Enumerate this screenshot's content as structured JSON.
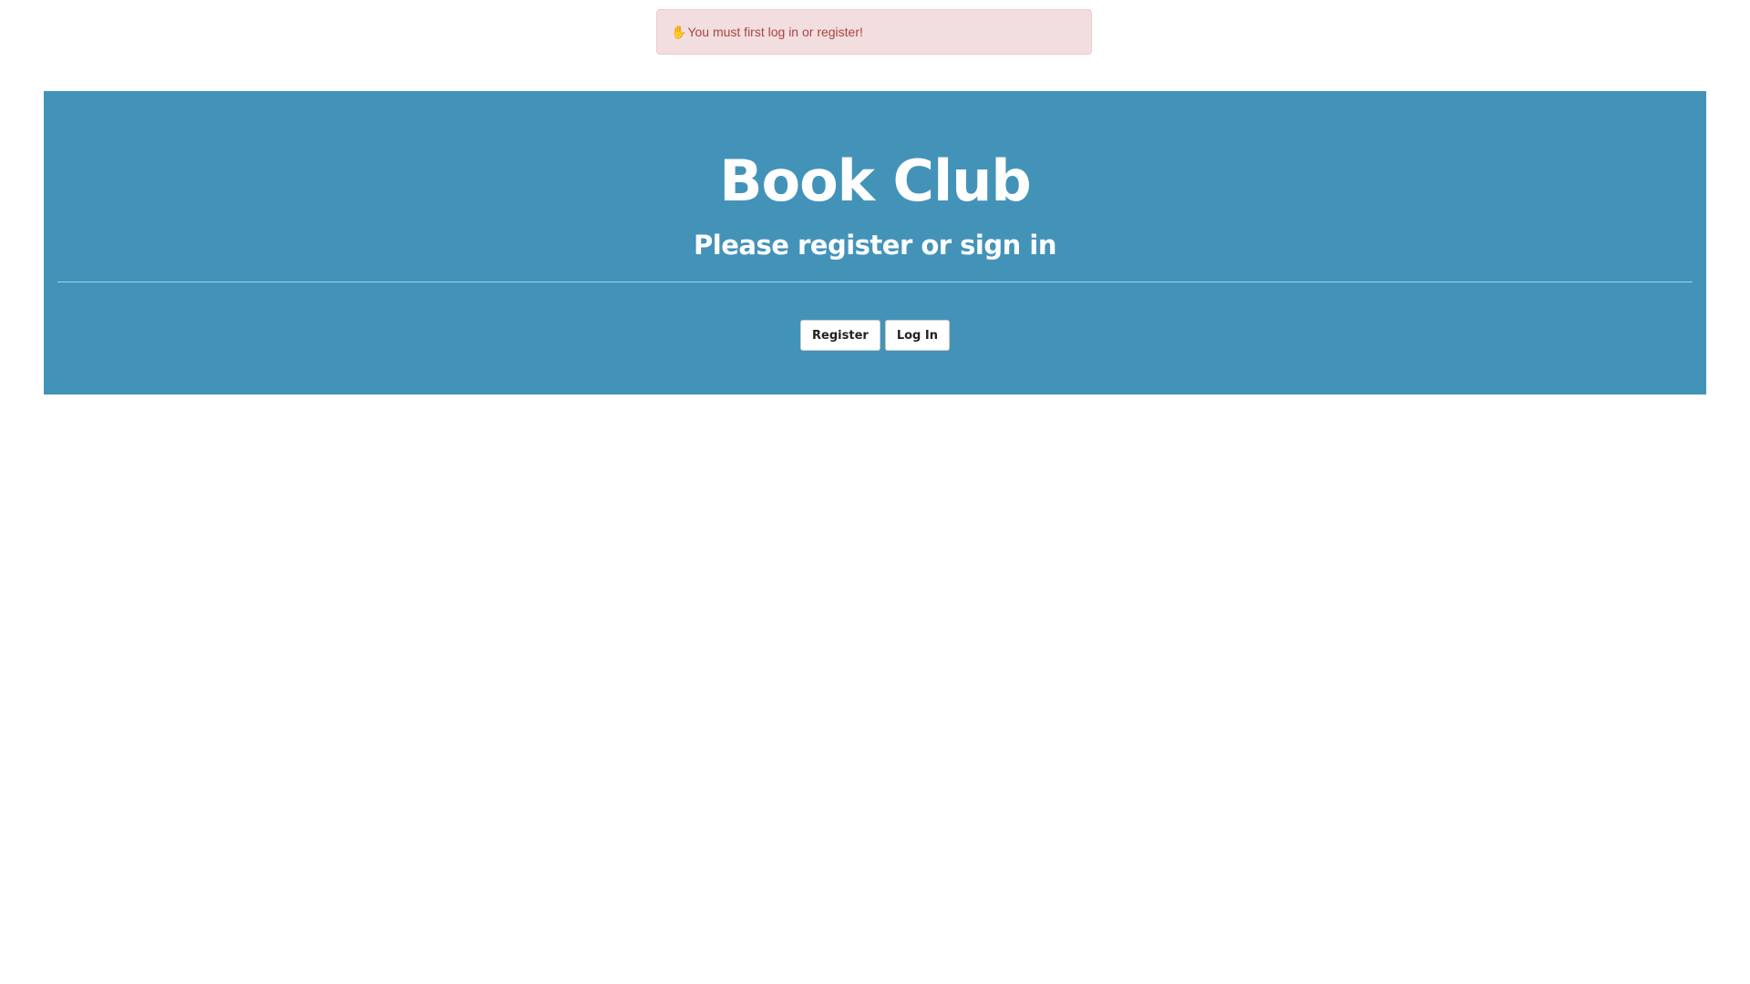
{
  "alert": {
    "icon": "hand-stop-icon",
    "message": "You must first log in or register!"
  },
  "banner": {
    "title": "Book Club",
    "subtitle": "Please register or sign in",
    "register_label": "Register",
    "login_label": "Log In"
  },
  "colors": {
    "banner": "#4393b9",
    "alert_bg": "#f2dede",
    "alert_text": "#a94442"
  }
}
